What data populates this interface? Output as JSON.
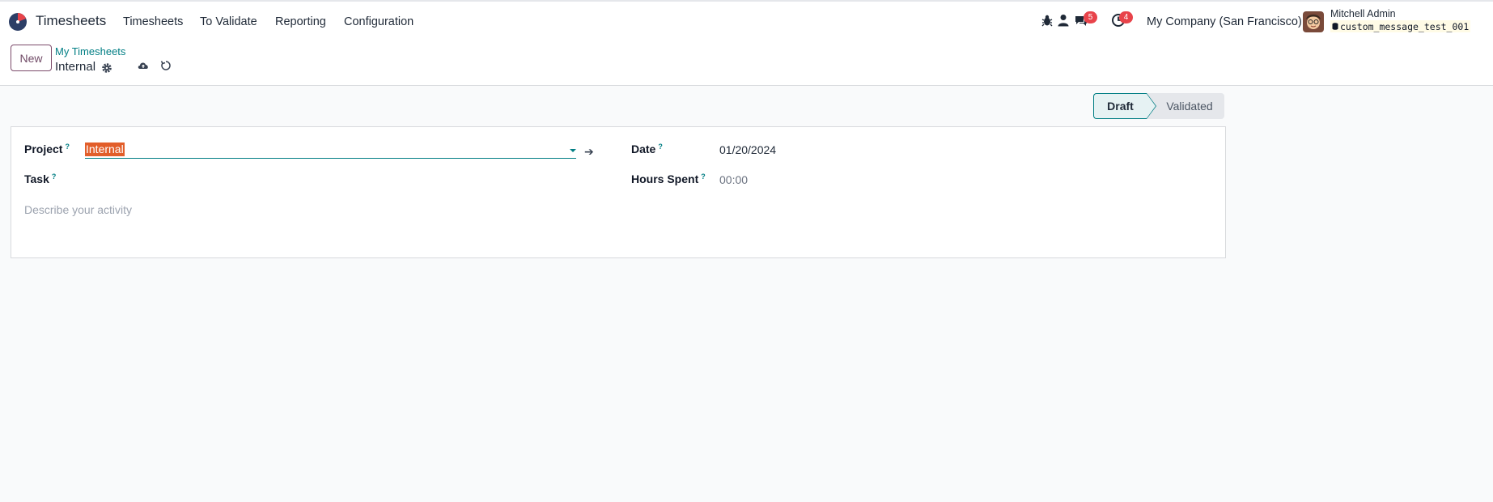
{
  "navbar": {
    "app_name": "Timesheets",
    "menu": [
      "Timesheets",
      "To Validate",
      "Reporting",
      "Configuration"
    ],
    "messages_badge": "5",
    "activities_badge": "4",
    "company": "My Company (San Francisco)",
    "user_name": "Mitchell Admin",
    "database": "custom_message_test_001",
    "icons": [
      "bug-icon",
      "person-icon",
      "chat-icon",
      "clock-icon",
      "database-icon"
    ]
  },
  "control_panel": {
    "new_label": "New",
    "breadcrumb": "My Timesheets",
    "record_name": "Internal"
  },
  "statusbar": {
    "draft": "Draft",
    "validated": "Validated"
  },
  "form": {
    "project_label": "Project",
    "project_value": "Internal",
    "task_label": "Task",
    "date_label": "Date",
    "date_value": "01/20/2024",
    "hours_label": "Hours Spent",
    "hours_value": "00:00",
    "description_placeholder": "Describe your activity",
    "help_mark": "?"
  },
  "colors": {
    "accent": "#017e84",
    "brand": "#714b67",
    "badge": "#e8434a",
    "selection": "#e25e2a"
  }
}
